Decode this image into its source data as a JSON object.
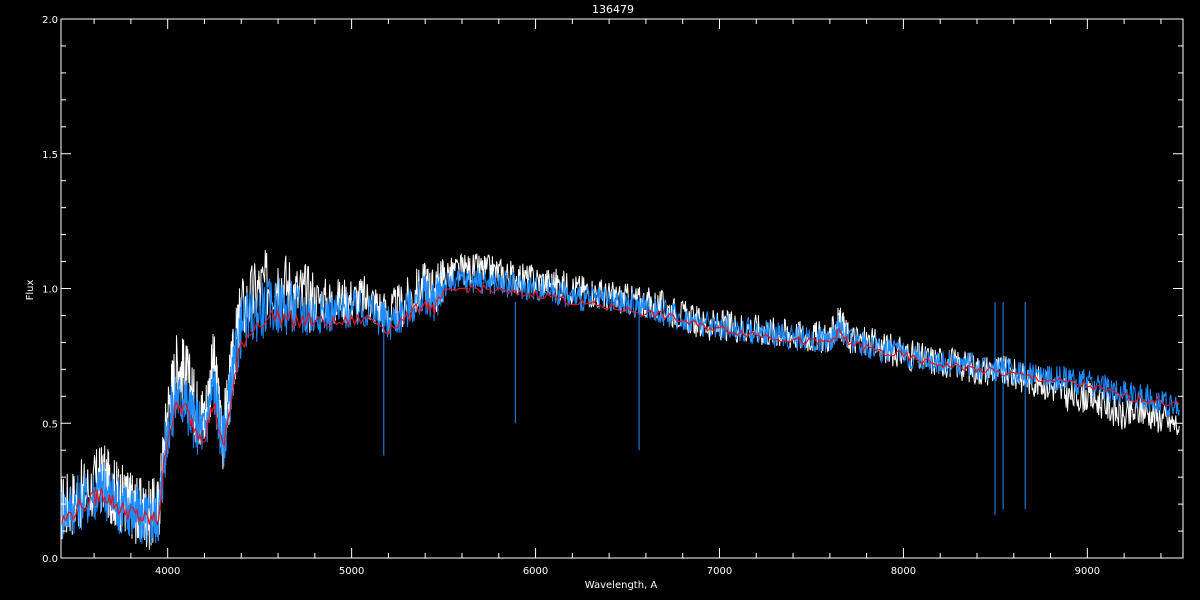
{
  "chart_data": {
    "type": "line",
    "title": "136479",
    "xlabel": "Wavelength, A",
    "ylabel": "Flux",
    "xlim": [
      3420,
      9520
    ],
    "ylim": [
      0.0,
      2.0
    ],
    "x_ticks": [
      4000,
      5000,
      6000,
      7000,
      8000,
      9000
    ],
    "x_tick_labels": [
      "4000",
      "5000",
      "6000",
      "7000",
      "8000",
      "9000"
    ],
    "y_ticks": [
      0.0,
      0.5,
      1.0,
      1.5,
      2.0
    ],
    "y_tick_labels": [
      "0.0",
      "0.5",
      "1.0",
      "1.5",
      "2.0"
    ],
    "grid": false,
    "background": "#000000",
    "axis_color": "#ffffff",
    "series": [
      {
        "color": "#ffffff",
        "x": [
          3420,
          3500,
          3600,
          3650,
          3700,
          3750,
          3800,
          3850,
          3900,
          3950,
          4000,
          4050,
          4100,
          4150,
          4200,
          4250,
          4300,
          4350,
          4400,
          4500,
          4600,
          4700,
          4800,
          4900,
          5000,
          5100,
          5200,
          5300,
          5400,
          5450,
          5500,
          5600,
          5700,
          5800,
          5900,
          6000,
          6100,
          6200,
          6300,
          6400,
          6500,
          6600,
          6700,
          6800,
          6900,
          7000,
          7100,
          7200,
          7300,
          7400,
          7500,
          7600,
          7650,
          7700,
          7800,
          7900,
          8000,
          8100,
          8200,
          8300,
          8400,
          8500,
          8600,
          8700,
          8800,
          8900,
          9000,
          9100,
          9200,
          9300,
          9400,
          9500
        ],
        "y": [
          0.18,
          0.22,
          0.27,
          0.3,
          0.25,
          0.22,
          0.2,
          0.17,
          0.16,
          0.18,
          0.55,
          0.72,
          0.68,
          0.56,
          0.52,
          0.72,
          0.45,
          0.7,
          0.92,
          1.0,
          1.04,
          0.98,
          0.96,
          0.95,
          0.96,
          0.96,
          0.9,
          0.95,
          1.02,
          0.98,
          1.05,
          1.07,
          1.07,
          1.06,
          1.04,
          1.03,
          1.02,
          1.0,
          0.99,
          0.97,
          0.96,
          0.95,
          0.93,
          0.9,
          0.87,
          0.86,
          0.86,
          0.85,
          0.84,
          0.83,
          0.82,
          0.82,
          0.88,
          0.82,
          0.8,
          0.78,
          0.76,
          0.74,
          0.73,
          0.72,
          0.7,
          0.7,
          0.68,
          0.66,
          0.64,
          0.6,
          0.6,
          0.57,
          0.52,
          0.55,
          0.52,
          0.49
        ]
      },
      {
        "color": "#1e8cff",
        "x": [
          3420,
          3500,
          3600,
          3650,
          3700,
          3750,
          3800,
          3850,
          3900,
          3950,
          4000,
          4050,
          4100,
          4150,
          4200,
          4250,
          4300,
          4350,
          4400,
          4500,
          4600,
          4700,
          4800,
          4900,
          5000,
          5100,
          5200,
          5300,
          5400,
          5450,
          5500,
          5600,
          5700,
          5800,
          5900,
          6000,
          6100,
          6200,
          6300,
          6400,
          6500,
          6600,
          6700,
          6800,
          6900,
          7000,
          7100,
          7200,
          7300,
          7400,
          7500,
          7600,
          7650,
          7700,
          7800,
          7900,
          8000,
          8100,
          8200,
          8300,
          8400,
          8500,
          8600,
          8700,
          8800,
          8900,
          9000,
          9100,
          9200,
          9300,
          9400,
          9500
        ],
        "y": [
          0.17,
          0.2,
          0.24,
          0.26,
          0.22,
          0.19,
          0.18,
          0.15,
          0.14,
          0.16,
          0.48,
          0.6,
          0.58,
          0.5,
          0.47,
          0.65,
          0.42,
          0.66,
          0.86,
          0.92,
          0.94,
          0.92,
          0.91,
          0.91,
          0.92,
          0.92,
          0.87,
          0.92,
          0.98,
          0.95,
          1.01,
          1.03,
          1.03,
          1.02,
          1.01,
          1.0,
          0.99,
          0.97,
          0.96,
          0.95,
          0.94,
          0.93,
          0.91,
          0.89,
          0.87,
          0.86,
          0.85,
          0.84,
          0.83,
          0.82,
          0.81,
          0.81,
          0.86,
          0.81,
          0.79,
          0.77,
          0.76,
          0.74,
          0.73,
          0.72,
          0.71,
          0.7,
          0.69,
          0.68,
          0.67,
          0.66,
          0.65,
          0.63,
          0.61,
          0.6,
          0.58,
          0.55
        ]
      },
      {
        "color": "#e0141e",
        "x": [
          3420,
          3500,
          3600,
          3650,
          3700,
          3750,
          3800,
          3850,
          3900,
          3950,
          4000,
          4050,
          4100,
          4150,
          4200,
          4250,
          4300,
          4350,
          4400,
          4500,
          4600,
          4700,
          4800,
          4900,
          5000,
          5100,
          5200,
          5300,
          5400,
          5450,
          5500,
          5600,
          5700,
          5800,
          5900,
          6000,
          6100,
          6200,
          6300,
          6400,
          6500,
          6600,
          6700,
          6800,
          6900,
          7000,
          7100,
          7200,
          7300,
          7400,
          7500,
          7600,
          7650,
          7700,
          7800,
          7900,
          8000,
          8100,
          8200,
          8300,
          8400,
          8500,
          8600,
          8700,
          8800,
          8900,
          9000,
          9100,
          9200,
          9300,
          9400,
          9500
        ],
        "y": [
          0.13,
          0.18,
          0.22,
          0.24,
          0.21,
          0.18,
          0.17,
          0.15,
          0.14,
          0.15,
          0.46,
          0.56,
          0.55,
          0.48,
          0.45,
          0.58,
          0.4,
          0.6,
          0.8,
          0.88,
          0.9,
          0.88,
          0.88,
          0.87,
          0.88,
          0.89,
          0.85,
          0.89,
          0.95,
          0.92,
          0.98,
          1.0,
          1.0,
          0.99,
          0.98,
          0.98,
          0.97,
          0.95,
          0.94,
          0.93,
          0.92,
          0.91,
          0.9,
          0.88,
          0.86,
          0.85,
          0.84,
          0.83,
          0.82,
          0.81,
          0.8,
          0.8,
          0.84,
          0.8,
          0.78,
          0.76,
          0.75,
          0.73,
          0.72,
          0.71,
          0.7,
          0.69,
          0.68,
          0.67,
          0.66,
          0.65,
          0.64,
          0.62,
          0.6,
          0.59,
          0.58,
          0.57
        ]
      }
    ],
    "absorption_lines": [
      {
        "x": 5175,
        "y": 0.38
      },
      {
        "x": 5890,
        "y": 0.5
      },
      {
        "x": 6563,
        "y": 0.4
      },
      {
        "x": 8498,
        "y": 0.16
      },
      {
        "x": 8542,
        "y": 0.18
      },
      {
        "x": 8662,
        "y": 0.18
      }
    ]
  }
}
